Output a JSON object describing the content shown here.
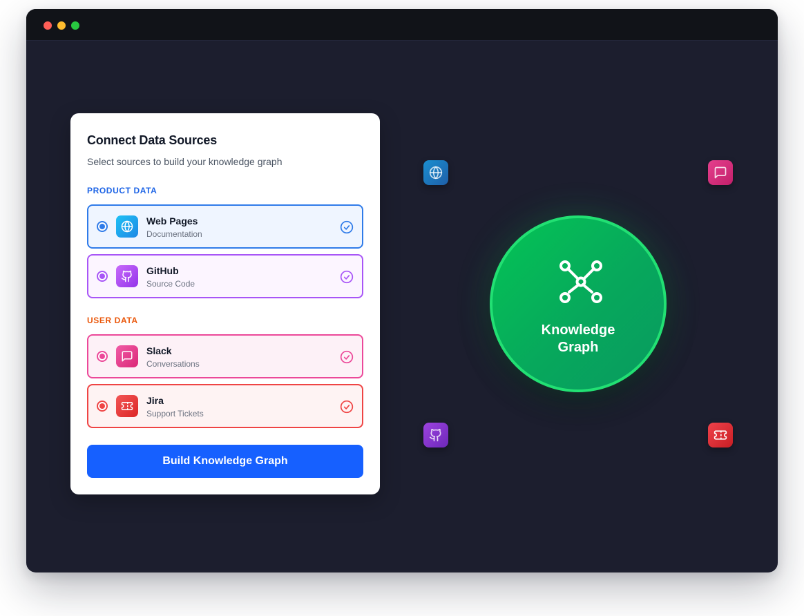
{
  "window": {
    "controls": [
      {
        "name": "close",
        "color": "#ff5f57"
      },
      {
        "name": "minimize",
        "color": "#febc2e"
      },
      {
        "name": "zoom",
        "color": "#28c840"
      }
    ]
  },
  "panel": {
    "title": "Connect Data Sources",
    "subtitle": "Select sources to build your knowledge graph",
    "sections": [
      {
        "label": "PRODUCT DATA",
        "color": "#1d64e6",
        "sources": [
          {
            "name": "Web Pages",
            "description": "Documentation",
            "icon": "globe-icon",
            "selected": true,
            "accent": "#2f7be9",
            "background": "#eff5ff",
            "icon_gradient": [
              "#1ec1f5",
              "#1e88e5"
            ]
          },
          {
            "name": "GitHub",
            "description": "Source Code",
            "icon": "github-icon",
            "selected": true,
            "accent": "#a855f7",
            "background": "#fcf5ff",
            "icon_gradient": [
              "#c86bfa",
              "#9333ea"
            ]
          }
        ]
      },
      {
        "label": "USER DATA",
        "color": "#ea580c",
        "sources": [
          {
            "name": "Slack",
            "description": "Conversations",
            "icon": "message-icon",
            "selected": true,
            "accent": "#ec4899",
            "background": "#fdf1f7",
            "icon_gradient": [
              "#f05ca6",
              "#db2777"
            ]
          },
          {
            "name": "Jira",
            "description": "Support Tickets",
            "icon": "ticket-icon",
            "selected": true,
            "accent": "#ef4444",
            "background": "#fef3f3",
            "icon_gradient": [
              "#f25656",
              "#dc2626"
            ]
          }
        ]
      }
    ],
    "build_button_label": "Build Knowledge Graph",
    "button_color": "#1660ff"
  },
  "graph": {
    "title_line1": "Knowledge",
    "title_line2": "Graph",
    "center_icon": "graph-nodes-icon",
    "satellite_icons": [
      {
        "icon": "globe-icon",
        "source": "Web Pages",
        "gradient": [
          "#1b8fd0",
          "#1e5fa8"
        ]
      },
      {
        "icon": "message-icon",
        "source": "Slack",
        "gradient": [
          "#e5408d",
          "#c21f6a"
        ]
      },
      {
        "icon": "github-icon",
        "source": "GitHub",
        "gradient": [
          "#9d43e0",
          "#6d28b8"
        ]
      },
      {
        "icon": "ticket-icon",
        "source": "Jira",
        "gradient": [
          "#f0424b",
          "#c81e24"
        ]
      }
    ]
  }
}
